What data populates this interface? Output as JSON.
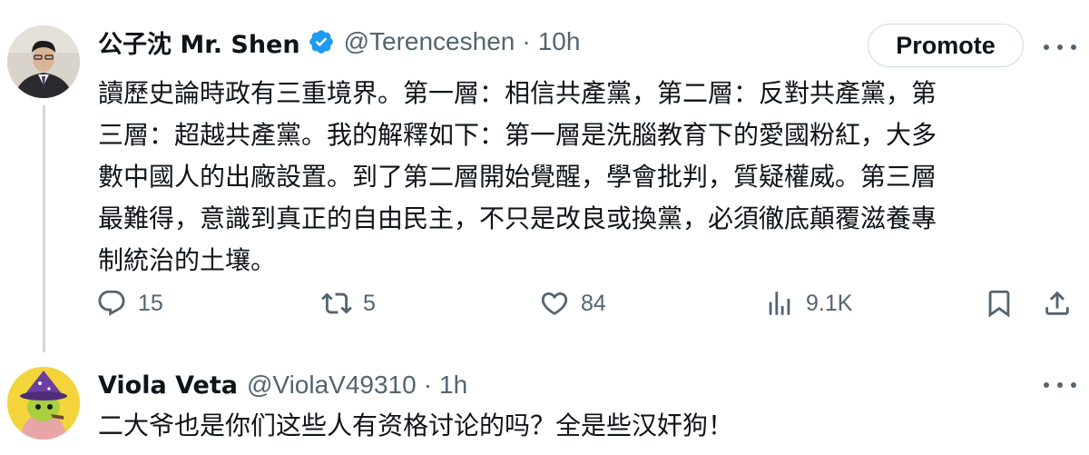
{
  "main_tweet": {
    "display_name": "公子沈 Mr. Shen",
    "handle": "@Terenceshen",
    "separator": "·",
    "time": "10h",
    "promote_label": "Promote",
    "text": "讀歷史論時政有三重境界。第一層：相信共產黨，第二層：反對共產黨，第\n三層：超越共產黨。我的解釋如下：第一層是洗腦教育下的愛國粉紅，大多\n數中國人的出廠設置。到了第二層開始覺醒，學會批判，質疑權威。第三層\n最難得，意識到真正的自由民主，不只是改良或換黨，必須徹底顛覆滋養專\n制統治的土壤。",
    "actions": {
      "replies": "15",
      "reposts": "5",
      "likes": "84",
      "views": "9.1K"
    }
  },
  "reply_tweet": {
    "display_name": "Viola Veta",
    "handle": "@ViolaV49310",
    "separator": "·",
    "time": "1h",
    "text": "二大爷也是你们这些人有资格讨论的吗？全是些汉奸狗！"
  },
  "colors": {
    "text_primary": "#0f1419",
    "text_secondary": "#536471",
    "verified_blue": "#1d9bf0",
    "border": "#cfd9de"
  },
  "icons": {
    "verified": "verified-badge-icon",
    "more": "more-icon",
    "reply": "reply-icon",
    "repost": "repost-icon",
    "like": "like-icon",
    "views": "views-icon",
    "bookmark": "bookmark-icon",
    "share": "share-icon"
  }
}
